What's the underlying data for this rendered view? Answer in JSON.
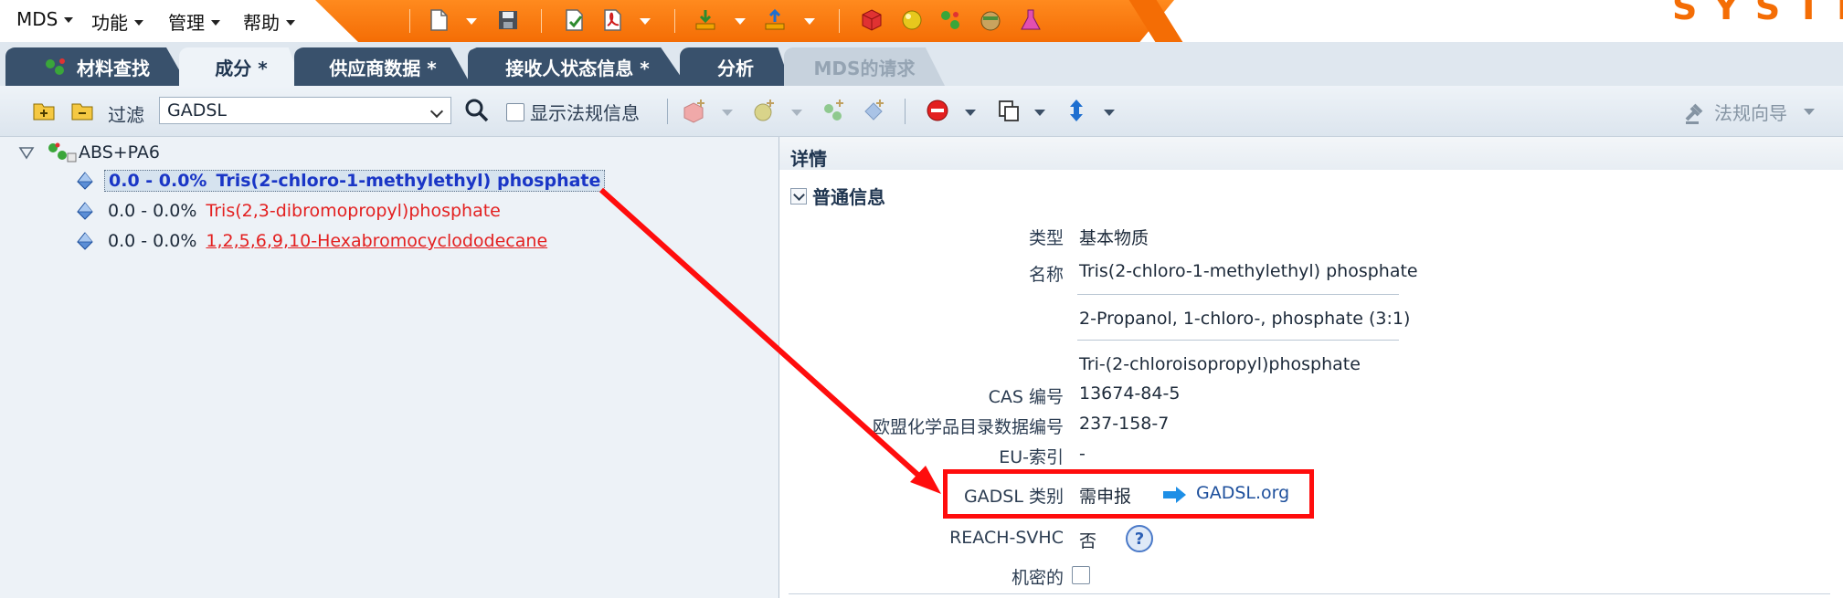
{
  "menubar": {
    "items": [
      {
        "label": "MDS"
      },
      {
        "label": "功能"
      },
      {
        "label": "管理"
      },
      {
        "label": "帮助"
      }
    ],
    "brand_text": "SYSTE"
  },
  "tabs": [
    {
      "label": "材料查找"
    },
    {
      "label": "成分 *"
    },
    {
      "label": "供应商数据 *"
    },
    {
      "label": "接收人状态信息 *"
    },
    {
      "label": "分析"
    },
    {
      "label": "MDS的请求"
    }
  ],
  "toolbar": {
    "filter_label": "过滤",
    "filter_value": "GADSL",
    "show_reg_label": "显示法规信息",
    "reg_wizard_label": "法规向导"
  },
  "tree": {
    "root": "ABS+PA6",
    "children": [
      {
        "pct": "0.0 - 0.0%",
        "name": "Tris(2-chloro-1-methylethyl) phosphate"
      },
      {
        "pct": "0.0 - 0.0%",
        "name": "Tris(2,3-dibromopropyl)phosphate"
      },
      {
        "pct": "0.0 - 0.0%",
        "name": "1,2,5,6,9,10-Hexabromocyclododecane"
      }
    ]
  },
  "details": {
    "title": "详情",
    "section": "普通信息",
    "type_label": "类型",
    "type_value": "基本物质",
    "name_label": "名称",
    "names": [
      "Tris(2-chloro-1-methylethyl) phosphate",
      "2-Propanol, 1-chloro-, phosphate (3:1)",
      "Tri-(2-chloroisopropyl)phosphate"
    ],
    "cas_label": "CAS 编号",
    "cas_value": "13674-84-5",
    "eu_inventory_label": "欧盟化学品目录数据编号",
    "eu_inventory_value": "237-158-7",
    "eu_index_label": "EU-索引",
    "eu_index_value": "-",
    "gadsl_label": "GADSL 类别",
    "gadsl_value": "需申报",
    "gadsl_link": "GADSL.org",
    "reach_label": "REACH-SVHC",
    "reach_value": "否",
    "confidential_label": "机密的"
  },
  "colors": {
    "accent_orange": "#f46d05",
    "tab_dark": "#39516c",
    "annotation_red": "#ff0d0d",
    "selected_blue": "#1a36c6",
    "hazard_red": "#e32020"
  }
}
